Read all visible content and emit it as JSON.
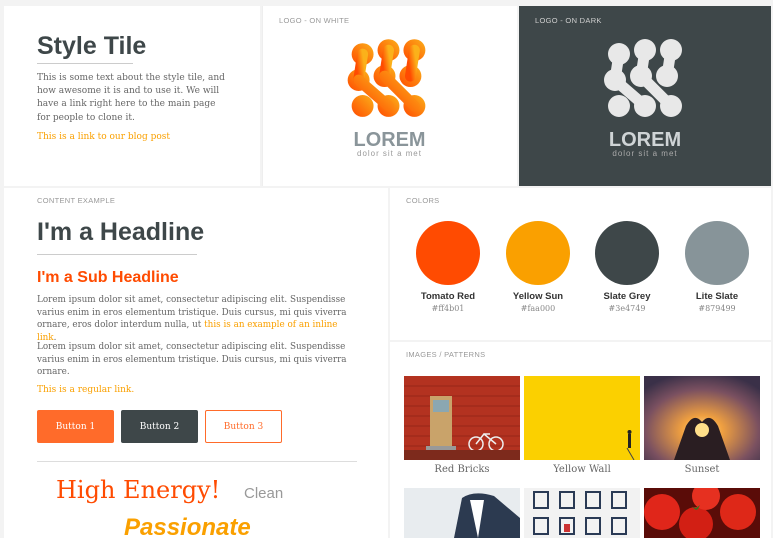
{
  "style_tile": {
    "title": "Style Tile",
    "intro": "This is some text about the style tile, and how awesome it is and to use it. We will have a link right here to the main page for people to clone it.",
    "blog_link": "This is a link to our blog post"
  },
  "logos": {
    "white_caption": "LOGO - ON WHITE",
    "dark_caption": "LOGO - ON DARK",
    "wordmark": "LOREM",
    "tagline": "dolor sit a met"
  },
  "content": {
    "caption": "CONTENT EXAMPLE",
    "headline": "I'm a Headline",
    "subheadline": "I'm a Sub Headline",
    "para1_text": "Lorem ipsum dolor sit amet, consectetur adipiscing elit. Suspendisse varius enim in eros elementum tristique. Duis cursus, mi quis viverra ornare, eros dolor interdum nulla, ut ",
    "para1_link": "this is an example of an inline link",
    "para1_end": ".",
    "para2": "Lorem ipsum dolor sit amet, consectetur adipiscing elit. Suspendisse varius enim in eros elementum tristique. Duis cursus, mi quis viverra ornare.",
    "regular_link": "This is a regular link.",
    "buttons": [
      "Button 1",
      "Button 2",
      "Button 3"
    ],
    "word_high_energy": "High Energy!",
    "word_clean": "Clean",
    "word_passionate": "Passionate"
  },
  "colors": {
    "caption": "COLORS",
    "swatches": [
      {
        "name": "Tomato Red",
        "hex": "#ff4b01"
      },
      {
        "name": "Yellow Sun",
        "hex": "#faa000"
      },
      {
        "name": "Slate Grey",
        "hex": "#3e4749"
      },
      {
        "name": "Lite Slate",
        "hex": "#879499"
      }
    ]
  },
  "images": {
    "caption": "IMAGES / PATTERNS",
    "tiles": [
      {
        "label": "Red Bricks"
      },
      {
        "label": "Yellow Wall"
      },
      {
        "label": "Sunset"
      }
    ]
  }
}
